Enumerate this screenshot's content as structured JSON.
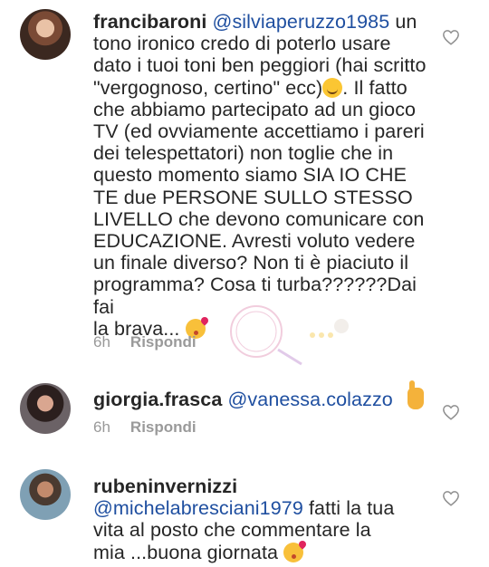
{
  "comments": [
    {
      "username": "francibaroni",
      "mention": "@silviaperuzzo1985",
      "lines": [
        " un",
        "tono ironico credo di poterlo usare",
        "dato i tuoi toni ben peggiori (hai scritto",
        "\"vergognoso, certino\" ecc)",
        ". Il fatto",
        "che abbiamo partecipato ad un gioco",
        "TV (ed ovviamente accettiamo i pareri",
        "dei telespettatori) non toglie che in",
        "questo momento siamo SIA IO CHE",
        "TE due PERSONE SULLO STESSO",
        "LIVELLO che devono comunicare con",
        "EDUCAZIONE. Avresti voluto vedere",
        "un finale diverso? Non ti è piaciuto il",
        "programma? Cosa ti turba??????Dai fai",
        "la brava... "
      ],
      "time": "6h",
      "reply": "Rispondi",
      "emoji_1": "smiling-face-icon",
      "emoji_2": "face-blowing-kiss-icon"
    },
    {
      "username": "giorgia.frasca",
      "mention": "@vanessa.colazzo",
      "time": "6h",
      "reply": "Rispondi",
      "emoji": "pointing-up-icon"
    },
    {
      "username": "rubeninvernizzi",
      "mention": "@michelabresciani1979",
      "lines": [
        " fatti la tua",
        "vita al posto che commentare la",
        "mia ...buona giornata "
      ],
      "emoji": "face-blowing-kiss-icon"
    }
  ],
  "colors": {
    "mention": "#1f4fa0",
    "text": "#262626",
    "meta": "#999999"
  }
}
